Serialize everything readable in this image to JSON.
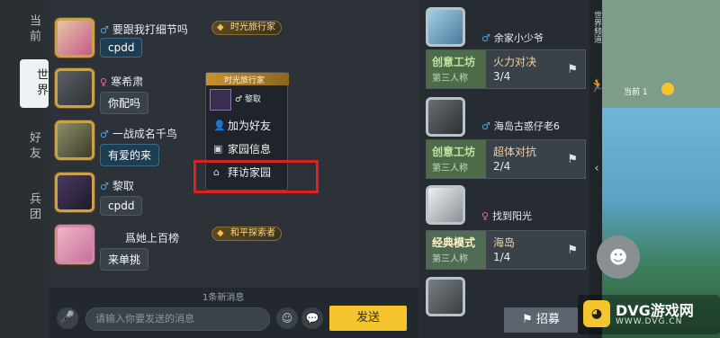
{
  "tabs": [
    {
      "label": "当前",
      "active": false
    },
    {
      "label": "世界",
      "active": true
    },
    {
      "label": "好友",
      "active": false
    },
    {
      "label": "兵团",
      "active": false
    }
  ],
  "messages": [
    {
      "name": "要跟我打细节吗",
      "gender": "♂",
      "text": "cpdd",
      "badge": "时光旅行家"
    },
    {
      "name": "寒希肃",
      "gender": "♀",
      "text": "你配吗",
      "badge": ""
    },
    {
      "name": "一战成名千鸟",
      "gender": "♂",
      "text": "有爱的来",
      "badge": ""
    },
    {
      "name": "黎取",
      "gender": "♂",
      "text": "cpdd",
      "badge": ""
    },
    {
      "name": "爲她上百榜",
      "gender": "",
      "text": "来单挑",
      "badge": "和平探索者"
    }
  ],
  "context_menu": {
    "header": "时光旅行家",
    "user_name": "♂ 黎取",
    "items": [
      {
        "label": "加为好友",
        "icon": "add-friend-icon"
      },
      {
        "label": "家园信息",
        "icon": "home-info-icon"
      },
      {
        "label": "拜访家园",
        "icon": "visit-home-icon"
      }
    ]
  },
  "input": {
    "placeholder": "请输入你要发送的消息",
    "send_label": "发送",
    "unread_label": "1条新消息"
  },
  "rooms": [
    {
      "host": "余家小少爷",
      "mode": "创意工坊",
      "sub": "第三人称",
      "title": "火力对决",
      "count": "3/4"
    },
    {
      "host": "海岛古惑仔老6",
      "mode": "创意工坊",
      "sub": "第三人称",
      "title": "超体对抗",
      "count": "2/4"
    },
    {
      "host": "找到阳光",
      "mode": "经典模式",
      "sub": "第三人称",
      "title": "海岛",
      "count": "1/4"
    }
  ],
  "recruit_label": "招募",
  "map": {
    "location_label": "当前 1",
    "side_label": "世界频道"
  },
  "watermark": {
    "text": "DVG游戏网",
    "sub": "WWW.DVG.CN"
  },
  "colors": {
    "accent": "#f5c52e",
    "highlight": "#e02020",
    "mode_green": "#4d6b48"
  }
}
